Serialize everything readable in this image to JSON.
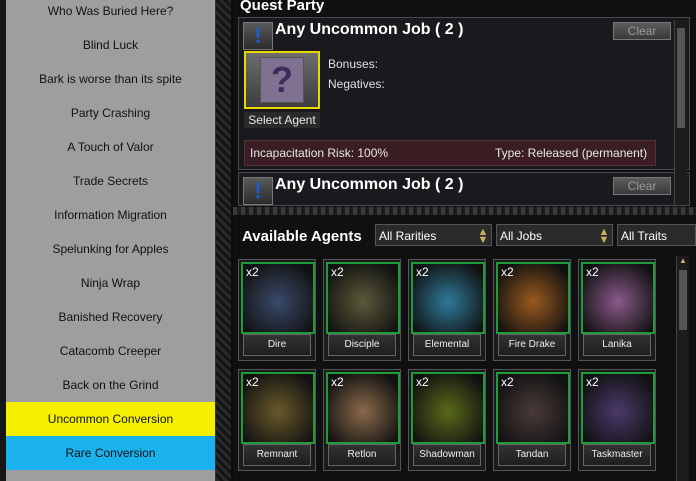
{
  "quest_list": [
    {
      "label": "Who Was Buried Here?",
      "highlight": ""
    },
    {
      "label": "Blind Luck",
      "highlight": ""
    },
    {
      "label": "Bark is worse than its spite",
      "highlight": ""
    },
    {
      "label": "Party Crashing",
      "highlight": ""
    },
    {
      "label": "A Touch of Valor",
      "highlight": ""
    },
    {
      "label": "Trade Secrets",
      "highlight": ""
    },
    {
      "label": "Information Migration",
      "highlight": ""
    },
    {
      "label": "Spelunking for Apples",
      "highlight": ""
    },
    {
      "label": "Ninja Wrap",
      "highlight": ""
    },
    {
      "label": "Banished Recovery",
      "highlight": ""
    },
    {
      "label": "Catacomb Creeper",
      "highlight": ""
    },
    {
      "label": "Back on the Grind",
      "highlight": ""
    },
    {
      "label": "Uncommon Conversion",
      "highlight": "yellow"
    },
    {
      "label": "Rare Conversion",
      "highlight": "cyan"
    }
  ],
  "quest_party": {
    "title": "Quest Party",
    "jobs": [
      {
        "icon": "!",
        "title": "Any Uncommon Job ( 2 )",
        "clear_label": "Clear",
        "bonuses_label": "Bonuses:",
        "negatives_label": "Negatives:",
        "select_label": "Select Agent",
        "select_icon": "?",
        "risk": "Incapacitation Risk: 100%",
        "type": "Type: Released (permanent)"
      },
      {
        "icon": "!",
        "title": "Any Uncommon Job ( 2 )",
        "clear_label": "Clear"
      }
    ]
  },
  "available": {
    "title": "Available Agents",
    "filters": [
      "All Rarities",
      "All Jobs",
      "All Traits"
    ],
    "agents": [
      {
        "name": "Dire",
        "count": "x2",
        "color": "#3a4a6a"
      },
      {
        "name": "Disciple",
        "count": "x2",
        "color": "#5b5a3a"
      },
      {
        "name": "Elemental",
        "count": "x2",
        "color": "#2f7a9a"
      },
      {
        "name": "Fire Drake",
        "count": "x2",
        "color": "#9a5a1e"
      },
      {
        "name": "Lanika",
        "count": "x2",
        "color": "#8a5a8a"
      },
      {
        "name": "Remnant",
        "count": "x2",
        "color": "#6a5a2a"
      },
      {
        "name": "Retlon",
        "count": "x2",
        "color": "#8a6a4a"
      },
      {
        "name": "Shadowman",
        "count": "x2",
        "color": "#5a6a1a"
      },
      {
        "name": "Tandan",
        "count": "x2",
        "color": "#4a3a3a"
      },
      {
        "name": "Taskmaster",
        "count": "x2",
        "color": "#4a3a6a"
      }
    ]
  },
  "colors": {
    "highlight_yellow": "#f4f000",
    "highlight_cyan": "#1ab2ec",
    "agent_border": "#1e9b3a"
  }
}
